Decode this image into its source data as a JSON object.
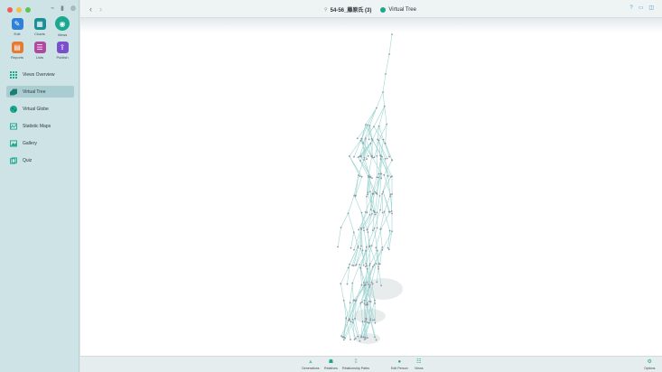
{
  "window": {
    "title_icon": "pin-icon",
    "document_title": "54-56_藤原氏 (3)",
    "view_title": "Virtual Tree"
  },
  "sidebar": {
    "tiles": [
      {
        "label": "Edit",
        "icon": "pencil-icon",
        "color": "#2f80d8"
      },
      {
        "label": "Charts",
        "icon": "chart-icon",
        "color": "#1b8f96"
      },
      {
        "label": "Views",
        "icon": "eye-icon",
        "color": "#1aa88f",
        "active": true
      },
      {
        "label": "Reports",
        "icon": "report-icon",
        "color": "#e57a35"
      },
      {
        "label": "Lists",
        "icon": "list-icon",
        "color": "#b04aa0"
      },
      {
        "label": "Publish",
        "icon": "publish-icon",
        "color": "#7b4fc9"
      }
    ],
    "nav": [
      {
        "label": "Views Overview",
        "icon": "grid-icon"
      },
      {
        "label": "Virtual Tree",
        "icon": "tree-icon",
        "selected": true
      },
      {
        "label": "Virtual Globe",
        "icon": "globe-icon"
      },
      {
        "label": "Statistic Maps",
        "icon": "map-icon"
      },
      {
        "label": "Gallery",
        "icon": "gallery-icon"
      },
      {
        "label": "Quiz",
        "icon": "quiz-icon"
      }
    ]
  },
  "bottom_toolbar": {
    "items": [
      {
        "label": "Generations",
        "icon": "generations-icon"
      },
      {
        "label": "Relatives",
        "icon": "relatives-icon"
      },
      {
        "label": "Relationship Paths",
        "icon": "relationship-paths-icon"
      },
      {
        "label": "Edit Person",
        "icon": "edit-person-icon"
      },
      {
        "label": "Views",
        "icon": "views-icon"
      },
      {
        "label": "Options",
        "icon": "options-icon"
      }
    ]
  },
  "colors": {
    "accent": "#1aa88f",
    "tree_line": "#9fd6d2",
    "tree_node": "#8d9aa8"
  }
}
